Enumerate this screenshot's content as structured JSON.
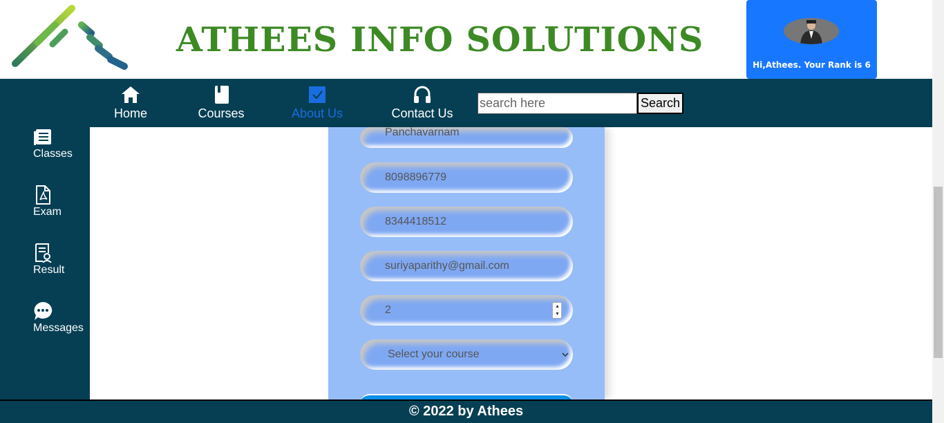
{
  "brand": {
    "title": "ATHEES INFO SOLUTIONS",
    "title_color": "#3d8a25"
  },
  "user": {
    "greeting": "Hi,Athees. Your Rank is 6",
    "card_color": "#1877ff"
  },
  "nav": {
    "items": [
      {
        "label": "Home",
        "icon": "home-icon"
      },
      {
        "label": "Courses",
        "icon": "book-icon"
      },
      {
        "label": "About Us",
        "icon": "checkbox-icon",
        "active": true
      },
      {
        "label": "Contact Us",
        "icon": "headphones-icon"
      }
    ],
    "search_placeholder": "search here",
    "search_button": "Search",
    "bg_color": "#063f53"
  },
  "sidebar": {
    "items": [
      {
        "label": "Classes",
        "icon": "document-list-icon"
      },
      {
        "label": "Exam",
        "icon": "pdf-file-icon"
      },
      {
        "label": "Result",
        "icon": "certificate-icon"
      },
      {
        "label": "Messages",
        "icon": "chat-icon"
      }
    ]
  },
  "form": {
    "fields": [
      {
        "value": "Panchavarnam"
      },
      {
        "value": "8098896779"
      },
      {
        "value": "8344418512"
      },
      {
        "value": "suriyaparithy@gmail.com"
      },
      {
        "value": "2"
      }
    ],
    "course_select": "Select your course",
    "panel_color": "#97bdf8"
  },
  "footer": {
    "text": "© 2022 by Athees"
  }
}
